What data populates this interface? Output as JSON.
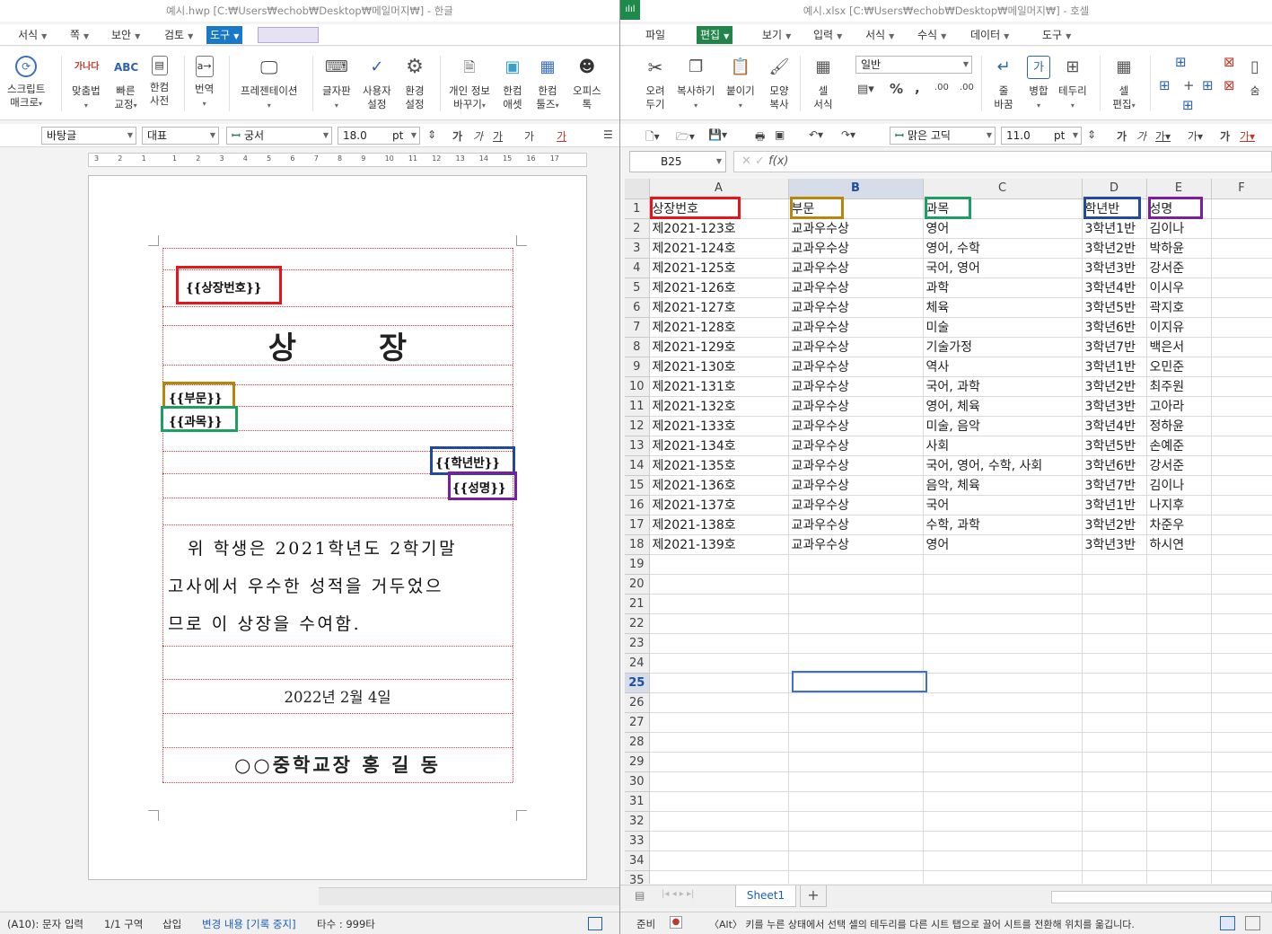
{
  "hwp": {
    "title": "예시.hwp [C:₩Users₩echob₩Desktop₩메일머지₩] - 한글",
    "menus": [
      {
        "label": "서식"
      },
      {
        "label": "쪽"
      },
      {
        "label": "보안"
      },
      {
        "label": "검토"
      },
      {
        "label": "도구"
      }
    ],
    "ribbon": [
      {
        "label1": "스크립트",
        "label2": "매크로",
        "icon": "script-icon"
      },
      {
        "label1": "맞춤법",
        "label2": "",
        "icon": "spellcheck-icon",
        "glyph": "가나다"
      },
      {
        "label1": "빠른",
        "label2": "교정",
        "icon": "quick-correct-icon",
        "glyph": "ABC"
      },
      {
        "label1": "한컴",
        "label2": "사전",
        "icon": "dictionary-icon"
      },
      {
        "label1": "번역",
        "label2": "",
        "icon": "translate-icon"
      },
      {
        "label1": "프레젠테이션",
        "label2": "",
        "icon": "presentation-icon"
      },
      {
        "label1": "글자판",
        "label2": "",
        "icon": "keyboard-icon"
      },
      {
        "label1": "사용자",
        "label2": "설정",
        "icon": "user-settings-icon"
      },
      {
        "label1": "환경",
        "label2": "설정",
        "icon": "gear-icon"
      },
      {
        "label1": "개인 정보",
        "label2": "바꾸기",
        "icon": "personal-info-icon"
      },
      {
        "label1": "한컴",
        "label2": "애셋",
        "icon": "asset-icon"
      },
      {
        "label1": "한컴",
        "label2": "툴즈",
        "icon": "tools-icon"
      },
      {
        "label1": "오피스",
        "label2": "톡",
        "icon": "office-talk-icon"
      }
    ],
    "style_combo": "바탕글",
    "outline_combo": "대표",
    "font_combo": "궁서",
    "size_value": "18.0",
    "size_unit": "pt",
    "ruler_numbers": [
      "3",
      "2",
      "1",
      "1",
      "2",
      "3",
      "4",
      "5",
      "6",
      "7",
      "8",
      "9",
      "10",
      "11",
      "12",
      "13",
      "14",
      "15",
      "16",
      "17"
    ],
    "document": {
      "field_award_no": "{{상장번호}}",
      "title": "상 장",
      "field_dept": "{{부문}}",
      "field_subject": "{{과목}}",
      "field_class": "{{학년반}}",
      "field_name": "{{성명}}",
      "body_line1": "위 학생은 2021학년도 2학기말",
      "body_line2": "고사에서 우수한 성적을 거두었으",
      "body_line3": "므로 이 상장을 수여함.",
      "date": "2022년 2월 4일",
      "signature": "○○중학교장 홍 길 동"
    },
    "status": {
      "mode": "(A10): 문자 입력",
      "section": "1/1 구역",
      "insert": "삽입",
      "track": "변경 내용 [기록 중지]",
      "count": "타수 : 999타"
    }
  },
  "cell": {
    "title": "예시.xlsx [C:₩Users₩echob₩Desktop₩메일머지₩] - 호셀",
    "logo": "ılıl",
    "menus": [
      {
        "label": "파일"
      },
      {
        "label": "편집"
      },
      {
        "label": "보기"
      },
      {
        "label": "입력"
      },
      {
        "label": "서식"
      },
      {
        "label": "수식"
      },
      {
        "label": "데이터"
      },
      {
        "label": "도구"
      }
    ],
    "ribbon": [
      {
        "label1": "오려",
        "label2": "두기",
        "icon": "scissors-icon"
      },
      {
        "label1": "복사하기",
        "label2": "",
        "icon": "copy-icon"
      },
      {
        "label1": "붙이기",
        "label2": "",
        "icon": "paste-icon"
      },
      {
        "label1": "모양",
        "label2": "복사",
        "icon": "format-painter-icon"
      },
      {
        "label1": "셀",
        "label2": "서식",
        "icon": "cell-format-icon"
      },
      {
        "label1": "줄",
        "label2": "바꿈",
        "icon": "wrap-text-icon"
      },
      {
        "label1": "병합",
        "label2": "",
        "icon": "merge-icon"
      },
      {
        "label1": "테두리",
        "label2": "",
        "icon": "border-icon"
      },
      {
        "label1": "셀",
        "label2": "편집",
        "icon": "cell-edit-icon"
      },
      {
        "label1": "숨",
        "label2": "",
        "icon": "hide-icon"
      }
    ],
    "number_format": "일반",
    "font_combo": "맑은 고딕",
    "size_value": "11.0",
    "size_unit": "pt",
    "name_box": "B25",
    "fx": "f(x)",
    "columns": [
      "A",
      "B",
      "C",
      "D",
      "E",
      "F"
    ],
    "rows": [
      [
        "상장번호",
        "부문",
        "과목",
        "학년반",
        "성명"
      ],
      [
        "제2021-123호",
        "교과우수상",
        "영어",
        "3학년1반",
        "김이나"
      ],
      [
        "제2021-124호",
        "교과우수상",
        "영어, 수학",
        "3학년2반",
        "박하윤"
      ],
      [
        "제2021-125호",
        "교과우수상",
        "국어, 영어",
        "3학년3반",
        "강서준"
      ],
      [
        "제2021-126호",
        "교과우수상",
        "과학",
        "3학년4반",
        "이시우"
      ],
      [
        "제2021-127호",
        "교과우수상",
        "체육",
        "3학년5반",
        "곽지호"
      ],
      [
        "제2021-128호",
        "교과우수상",
        "미술",
        "3학년6반",
        "이지유"
      ],
      [
        "제2021-129호",
        "교과우수상",
        "기술가정",
        "3학년7반",
        "백은서"
      ],
      [
        "제2021-130호",
        "교과우수상",
        "역사",
        "3학년1반",
        "오민준"
      ],
      [
        "제2021-131호",
        "교과우수상",
        "국어, 과학",
        "3학년2반",
        "최주원"
      ],
      [
        "제2021-132호",
        "교과우수상",
        "영어, 체육",
        "3학년3반",
        "고아라"
      ],
      [
        "제2021-133호",
        "교과우수상",
        "미술, 음악",
        "3학년4반",
        "정하윤"
      ],
      [
        "제2021-134호",
        "교과우수상",
        "사회",
        "3학년5반",
        "손예준"
      ],
      [
        "제2021-135호",
        "교과우수상",
        "국어, 영어, 수학, 사회",
        "3학년6반",
        "강서준"
      ],
      [
        "제2021-136호",
        "교과우수상",
        "음악, 체육",
        "3학년7반",
        "김이나"
      ],
      [
        "제2021-137호",
        "교과우수상",
        "국어",
        "3학년1반",
        "나지후"
      ],
      [
        "제2021-138호",
        "교과우수상",
        "수학, 과학",
        "3학년2반",
        "차준우"
      ],
      [
        "제2021-139호",
        "교과우수상",
        "영어",
        "3학년3반",
        "하시연"
      ]
    ],
    "total_rows": 35,
    "selected_row": 25,
    "selected_col": "B",
    "sheet_tab": "Sheet1",
    "status": {
      "ready": "준비",
      "hint": "〈Alt〉 키를 누른 상태에서 선택 셀의 테두리를 다른 시트 탭으로 끌어 시트를 전환해 위치를 옮깁니다."
    }
  },
  "colors": {
    "red": "#e8141c",
    "gold": "#b8860b",
    "green": "#1f9e62",
    "blue": "#1f4aa0",
    "purple": "#7b1fa2",
    "hwp_active": "#1a78c8",
    "cell_active": "#21854a"
  }
}
